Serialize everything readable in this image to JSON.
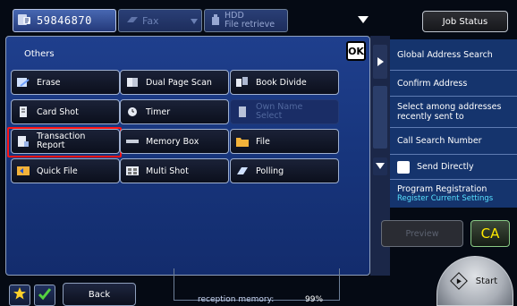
{
  "tabs": {
    "address_number": "59846870",
    "fax_label": "Fax",
    "hdd_line1": "HDD",
    "hdd_line2": "File retrieve"
  },
  "panel": {
    "title": "Others",
    "ok_label": "OK",
    "items": [
      {
        "label": "Erase",
        "icon": "erase-icon"
      },
      {
        "label": "Dual Page Scan",
        "icon": "dual-page-scan-icon"
      },
      {
        "label": "Book Divide",
        "icon": "book-divide-icon"
      },
      {
        "label": "Card Shot",
        "icon": "card-shot-icon"
      },
      {
        "label": "Timer",
        "icon": "timer-icon"
      },
      {
        "label_line1": "Own Name",
        "label_line2": "Select",
        "icon": "own-name-select-icon",
        "disabled": true
      },
      {
        "label_line1": "Transaction",
        "label_line2": "Report",
        "icon": "transaction-report-icon",
        "selected": true
      },
      {
        "label": "Memory Box",
        "icon": "memory-box-icon"
      },
      {
        "label": "File",
        "icon": "folder-icon"
      },
      {
        "label": "Quick File",
        "icon": "quick-file-icon"
      },
      {
        "label": "Multi Shot",
        "icon": "multi-shot-icon"
      },
      {
        "label": "Polling",
        "icon": "polling-icon"
      }
    ]
  },
  "footer": {
    "back_label": "Back",
    "memory_label": "reception memory:",
    "memory_value": "99%"
  },
  "right": {
    "job_status_label": "Job Status",
    "items": [
      {
        "label": "Global Address Search"
      },
      {
        "label": "Confirm Address"
      },
      {
        "label": "Select among addresses recently sent to"
      },
      {
        "label": "Call Search Number"
      },
      {
        "label": "Send Directly"
      },
      {
        "label": "Program Registration",
        "sub": "Register Current Settings"
      }
    ],
    "preview_label": "Preview",
    "ca_label": "CA",
    "start_label": "Start"
  },
  "colors": {
    "panel_blue": "#17357c",
    "selection_red": "#ff1414",
    "ca_yellow": "#ffea00",
    "sub_cyan": "#57e0ff"
  }
}
